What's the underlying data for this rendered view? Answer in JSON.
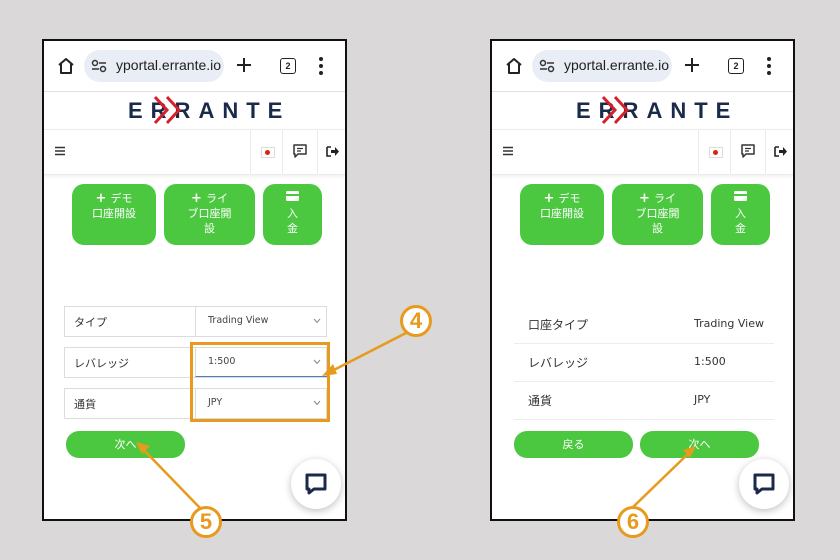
{
  "browser": {
    "url": "yportal.errante.io",
    "tab_count": "2"
  },
  "brand": {
    "logo_text": "ERRANTE",
    "accent_color": "#4bc840",
    "logo_color": "#1b2a4a",
    "logo_accent_color": "#d6202a",
    "annotation_color": "#e79a1c"
  },
  "top_buttons": {
    "demo_line1": "デモ",
    "demo_line2": "口座開設",
    "live_line1": "ライ",
    "live_line2": "ブ口座開",
    "live_line3": "設",
    "deposit_line1": "入",
    "deposit_line2": "金"
  },
  "left_form": {
    "type_label": "タイプ",
    "type_value": "Trading View",
    "leverage_label": "レバレッジ",
    "leverage_value": "1:500",
    "currency_label": "通貨",
    "currency_value": "JPY",
    "next_label": "次へ"
  },
  "right_summary": {
    "account_type_label": "口座タイプ",
    "account_type_value": "Trading View",
    "leverage_label": "レバレッジ",
    "leverage_value": "1:500",
    "currency_label": "通貨",
    "currency_value": "JPY",
    "back_label": "戻る",
    "next_label": "次へ"
  },
  "annotations": {
    "step_4": "4",
    "step_5": "5",
    "step_6": "6"
  }
}
